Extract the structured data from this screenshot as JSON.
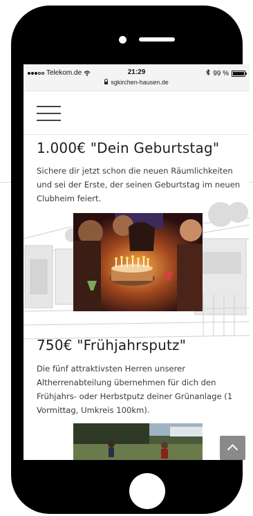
{
  "status_bar": {
    "carrier": "Telekom.de",
    "time": "21:29",
    "battery": "99 %",
    "battery_level": 0.99,
    "url": "sgkirchen-hausen.de"
  },
  "header": {
    "menu_icon": "hamburger-menu-icon"
  },
  "sections": [
    {
      "title": "1.000€ \"Dein Geburtstag\"",
      "text": "Sichere dir jetzt schon die neuen Räumlichkeiten und sei der Erste, der seinen Geburtstag im neuen Clubheim feiert."
    },
    {
      "title": "750€ \"Frühjahrsputz\"",
      "text": "Die fünf attraktivsten Herren unserer Altherrenabteilung übernehmen für dich den Frühjahrs- oder Herbstputz deiner Grünanlage (1 Vormittag, Umkreis 100km)."
    }
  ],
  "scroll_top_icon": "chevron-up-icon",
  "colors": {
    "phone": "#000000",
    "status_bar": "#f4f4f4",
    "text": "#3a3a3a",
    "heading": "#1e1e1e",
    "scroll_button": "#8a8a8a"
  }
}
